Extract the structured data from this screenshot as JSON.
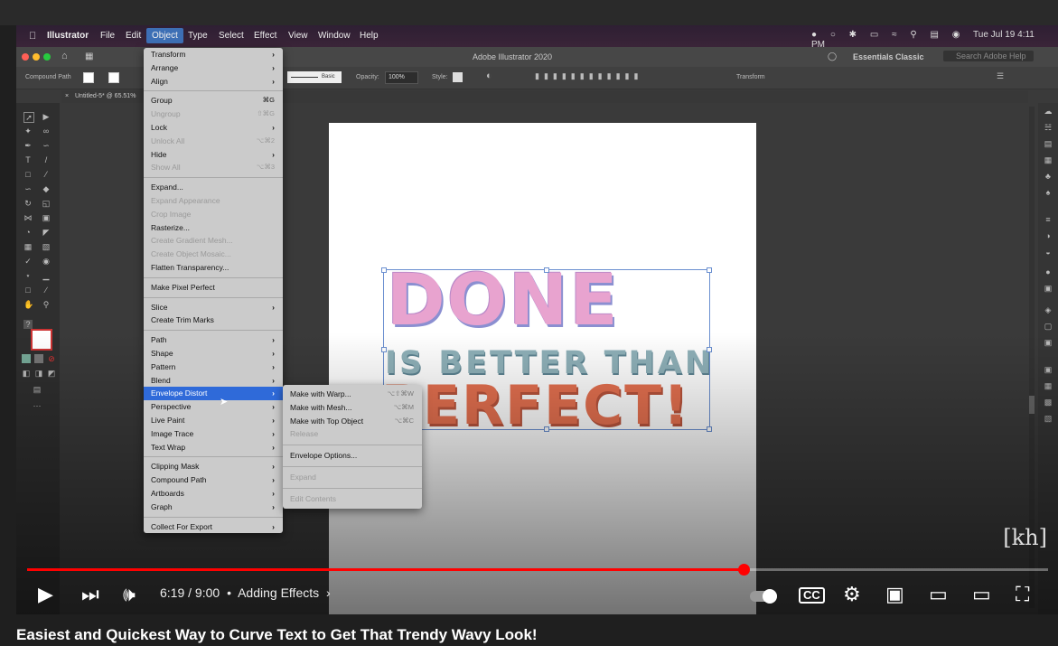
{
  "os_menubar": {
    "app_name": "Illustrator",
    "menus": [
      "File",
      "Edit",
      "Object",
      "Type",
      "Select",
      "Effect",
      "View",
      "Window",
      "Help"
    ],
    "active_menu": "Object",
    "clock": "Tue Jul 19  4:11 PM"
  },
  "window": {
    "title": "Adobe Illustrator 2020",
    "workspace": "Essentials Classic",
    "search_placeholder": "Search Adobe Help",
    "doc_tab": "Untitled-5* @ 65.51%"
  },
  "control_bar": {
    "selection_type": "Compound Path",
    "stroke_style": "Basic",
    "opacity_label": "Opacity:",
    "opacity_value": "100%",
    "style_label": "Style:",
    "transform_label": "Transform"
  },
  "artwork": {
    "line1": "DONE",
    "line2": "IS BETTER THAN",
    "line3": "PERFECT!",
    "colors": {
      "pink": "#e8a3cf",
      "teal": "#8fb1b9",
      "orange": "#e67150",
      "selection": "#6a8fd0"
    }
  },
  "object_menu": [
    {
      "label": "Transform",
      "arrow": true
    },
    {
      "label": "Arrange",
      "arrow": true
    },
    {
      "label": "Align",
      "arrow": true
    },
    {
      "sep": true
    },
    {
      "label": "Group",
      "shortcut": "⌘G"
    },
    {
      "label": "Ungroup",
      "shortcut": "⇧⌘G",
      "disabled": true
    },
    {
      "label": "Lock",
      "arrow": true
    },
    {
      "label": "Unlock All",
      "shortcut": "⌥⌘2",
      "disabled": true
    },
    {
      "label": "Hide",
      "arrow": true
    },
    {
      "label": "Show All",
      "shortcut": "⌥⌘3",
      "disabled": true
    },
    {
      "sep": true
    },
    {
      "label": "Expand..."
    },
    {
      "label": "Expand Appearance",
      "disabled": true
    },
    {
      "label": "Crop Image",
      "disabled": true
    },
    {
      "label": "Rasterize..."
    },
    {
      "label": "Create Gradient Mesh...",
      "disabled": true
    },
    {
      "label": "Create Object Mosaic...",
      "disabled": true
    },
    {
      "label": "Flatten Transparency..."
    },
    {
      "sep": true
    },
    {
      "label": "Make Pixel Perfect"
    },
    {
      "sep": true
    },
    {
      "label": "Slice",
      "arrow": true
    },
    {
      "label": "Create Trim Marks"
    },
    {
      "sep": true
    },
    {
      "label": "Path",
      "arrow": true
    },
    {
      "label": "Shape",
      "arrow": true
    },
    {
      "label": "Pattern",
      "arrow": true
    },
    {
      "label": "Blend",
      "arrow": true
    },
    {
      "label": "Envelope Distort",
      "arrow": true,
      "highlighted": true
    },
    {
      "label": "Perspective",
      "arrow": true
    },
    {
      "label": "Live Paint",
      "arrow": true
    },
    {
      "label": "Image Trace",
      "arrow": true
    },
    {
      "label": "Text Wrap",
      "arrow": true
    },
    {
      "sep": true
    },
    {
      "label": "Clipping Mask",
      "arrow": true
    },
    {
      "label": "Compound Path",
      "arrow": true
    },
    {
      "label": "Artboards",
      "arrow": true
    },
    {
      "label": "Graph",
      "arrow": true
    },
    {
      "sep": true
    },
    {
      "label": "Collect For Export",
      "arrow": true
    }
  ],
  "envelope_submenu": [
    {
      "label": "Make with Warp...",
      "shortcut": "⌥⇧⌘W"
    },
    {
      "label": "Make with Mesh...",
      "shortcut": "⌥⌘M"
    },
    {
      "label": "Make with Top Object",
      "shortcut": "⌥⌘C"
    },
    {
      "label": "Release",
      "disabled": true
    },
    {
      "sep": true
    },
    {
      "label": "Envelope Options..."
    },
    {
      "sep": true
    },
    {
      "label": "Expand",
      "disabled": true
    },
    {
      "sep": true
    },
    {
      "label": "Edit Contents",
      "disabled": true
    }
  ],
  "watermark": "[kh]",
  "player": {
    "time": "6:19 / 9:00",
    "chapter": "Adding Effects",
    "progress_fraction": 0.702,
    "icons": {
      "play": "play-icon",
      "next": "next-icon",
      "volume": "volume-icon",
      "autoplay": "autoplay-toggle-icon",
      "captions": "cc-icon",
      "settings": "gear-icon",
      "miniplayer": "miniplayer-icon",
      "theater": "theater-icon",
      "airplay": "airplay-icon",
      "fullscreen": "fullscreen-icon"
    }
  },
  "video_title": "Easiest and Quickest Way to Curve Text to Get That Trendy Wavy Look!"
}
